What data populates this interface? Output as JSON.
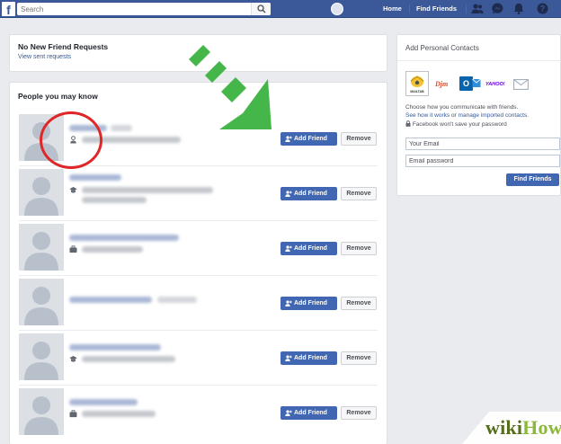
{
  "topbar": {
    "logo": "f",
    "search_placeholder": "Search",
    "nav": {
      "home": "Home",
      "find_friends": "Find Friends"
    },
    "icons": [
      "friend-requests-icon",
      "messages-icon",
      "notifications-icon",
      "help-icon"
    ]
  },
  "requests": {
    "title": "No New Friend Requests",
    "link": "View sent requests"
  },
  "pymk": {
    "title": "People you may know",
    "add_label": "Add Friend",
    "remove_label": "Remove",
    "people": [
      {
        "sub_icon": "person-icon"
      },
      {
        "sub_icon": "graduation-cap-icon"
      },
      {
        "sub_icon": "briefcase-icon"
      },
      {
        "sub_icon": "none"
      },
      {
        "sub_icon": "graduation-cap-icon"
      },
      {
        "sub_icon": "briefcase-icon"
      }
    ]
  },
  "contacts": {
    "title": "Add Personal Contacts",
    "providers": {
      "selected": "MAILTAB",
      "p2": "Djm",
      "p3": "O",
      "p4": "YAHOO!",
      "p5": "mail-icon"
    },
    "choose_prefix": "Choose how you communicate with friends.",
    "see_how": "See how it works",
    "or": " or ",
    "manage": "manage imported contacts",
    "period": ".",
    "note": "Facebook won't save your password",
    "email_placeholder": "Your Email",
    "password_placeholder": "Email password",
    "find_button": "Find Friends"
  },
  "watermark": {
    "wiki": "wiki",
    "how": "How"
  },
  "colors": {
    "brand": "#3b5998",
    "button": "#4267b2",
    "arrow": "#45b649",
    "circle": "#e02626"
  }
}
